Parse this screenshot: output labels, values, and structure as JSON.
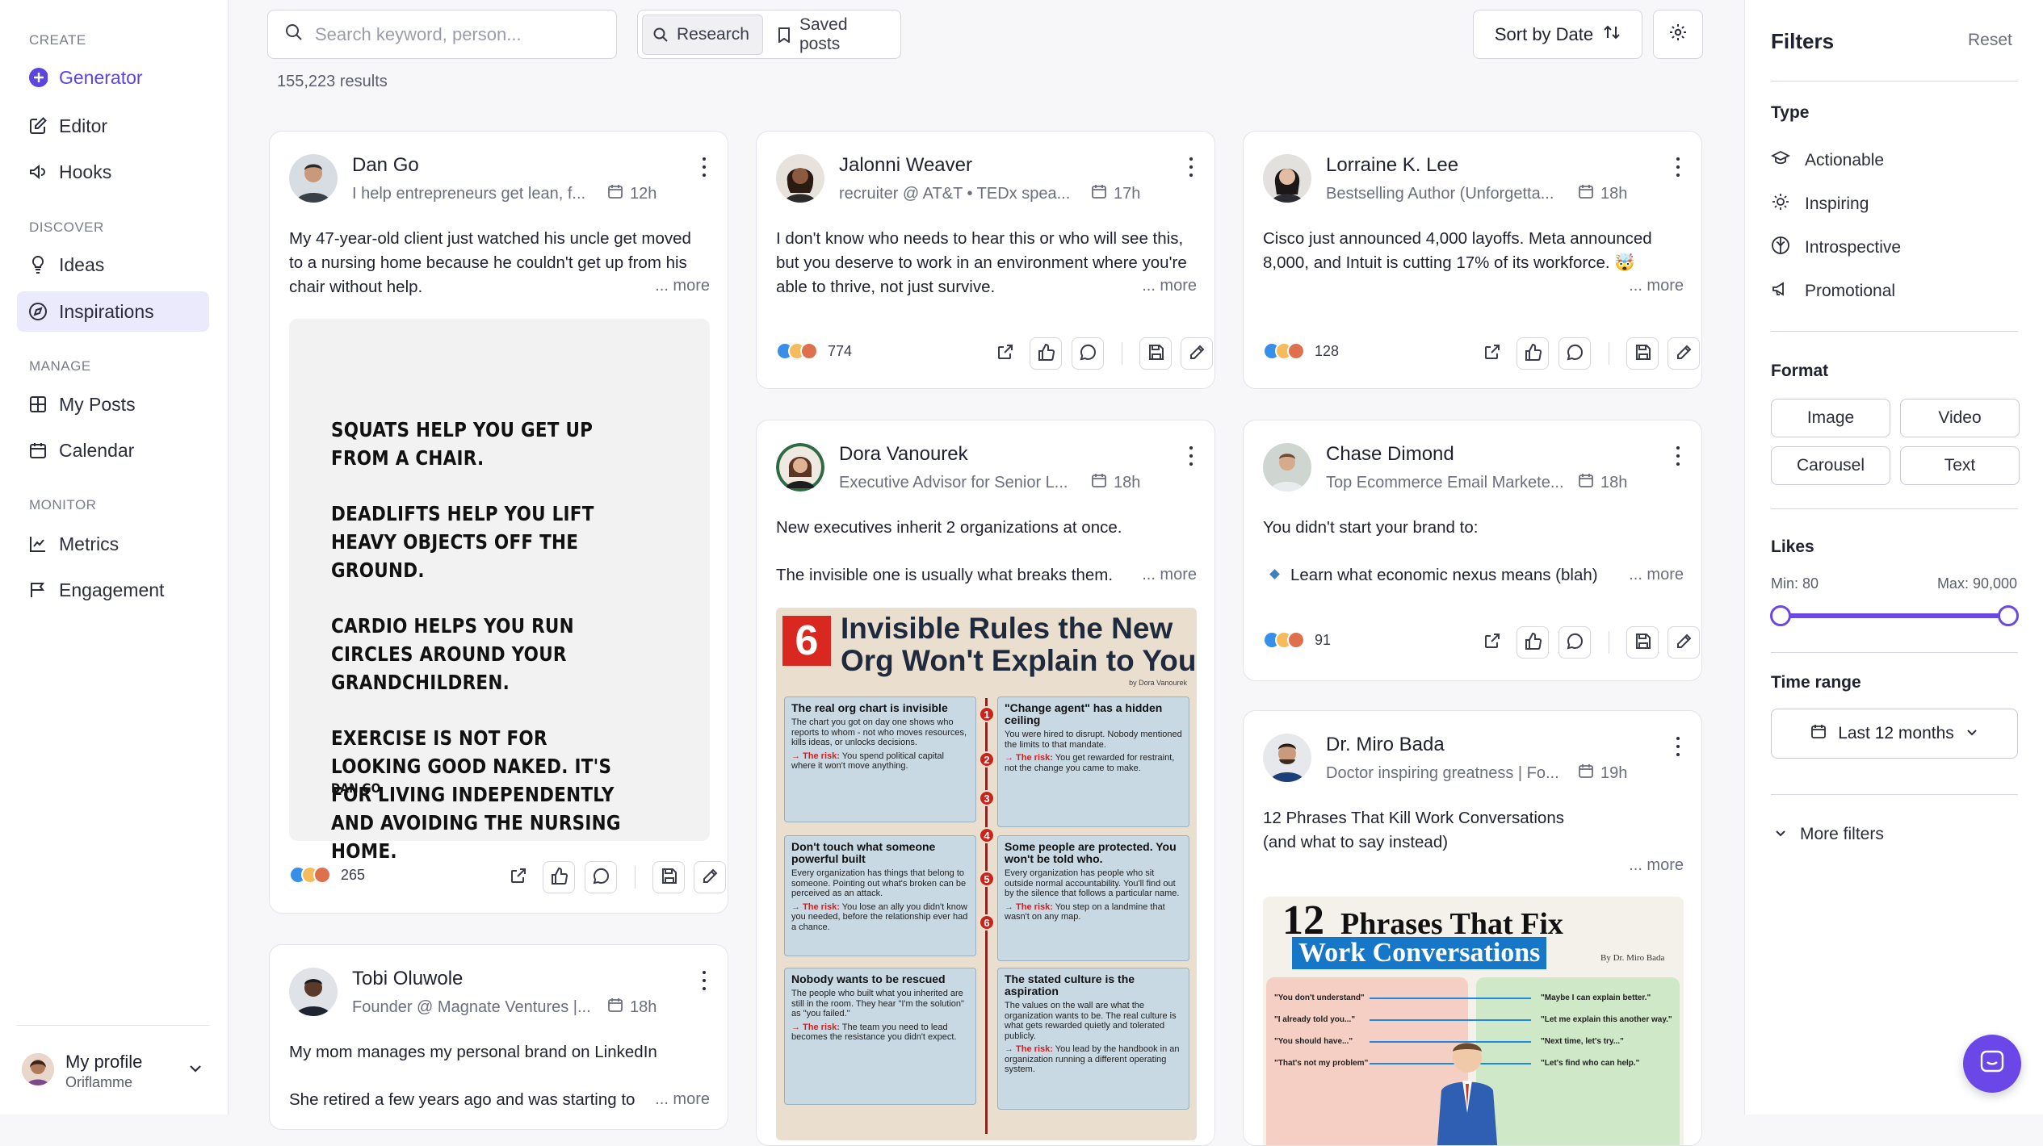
{
  "sidebar": {
    "sections": {
      "create": "CREATE",
      "discover": "DISCOVER",
      "manage": "MANAGE",
      "monitor": "MONITOR"
    },
    "items": {
      "generator": "Generator",
      "editor": "Editor",
      "hooks": "Hooks",
      "ideas": "Ideas",
      "inspirations": "Inspirations",
      "my_posts": "My Posts",
      "calendar": "Calendar",
      "metrics": "Metrics",
      "engagement": "Engagement"
    },
    "profile": {
      "name": "My profile",
      "org": "Oriflamme"
    },
    "accent": "#5b45e0"
  },
  "toolbar": {
    "search_placeholder": "Search keyword, person...",
    "research": "Research",
    "saved_posts": "Saved posts",
    "sort": "Sort by Date",
    "results": "155,223 results"
  },
  "posts": [
    {
      "name": "Dan Go",
      "sub": "I help entrepreneurs get lean, f...",
      "time": "12h",
      "text": "My 47-year-old client just watched his uncle get moved to a nursing home because he couldn't get up from his chair without help.",
      "more": "... more",
      "likes": "265",
      "quote": [
        "SQUATS HELP YOU GET UP FROM A CHAIR.",
        "DEADLIFTS HELP YOU LIFT HEAVY OBJECTS OFF THE GROUND.",
        "CARDIO HELPS YOU RUN CIRCLES AROUND YOUR GRANDCHILDREN.",
        "EXERCISE IS NOT FOR LOOKING GOOD NAKED. IT'S FOR LIVING INDEPENDENTLY AND AVOIDING THE NURSING HOME."
      ],
      "quote_author": "DAN GO"
    },
    {
      "name": "Tobi Oluwole",
      "sub": "Founder @ Magnate Ventures |...",
      "time": "18h",
      "text1": "My mom manages my personal brand on LinkedIn",
      "text2": "She retired a few years ago and was starting to",
      "more": "... more"
    },
    {
      "name": "Jalonni Weaver",
      "sub": "recruiter @ AT&T • TEDx spea...",
      "time": "17h",
      "text": "I don't know who needs to hear this or who will see this, but you deserve to work in an environment where you're able to thrive, not just survive.",
      "more": "... more",
      "likes": "774"
    },
    {
      "name": "Dora Vanourek",
      "sub": "Executive Advisor for Senior L...",
      "time": "18h",
      "text1": "New executives inherit 2 organizations at once.",
      "text2": "The invisible one is usually what breaks them.",
      "more": "... more",
      "infographic": {
        "num": "6",
        "title1": "Invisible Rules the New",
        "title2": "Org Won't Explain to You",
        "byline": "by Dora Vanourek",
        "risk_label": "→ The risk:",
        "rules": [
          {
            "n": "1",
            "head": "The real org chart is invisible",
            "body": "The chart you got on day one shows who reports to whom - not who moves resources, kills ideas, or unlocks decisions.",
            "risk": "You spend political capital where it won't move anything."
          },
          {
            "n": "2",
            "head": "\"Change agent\" has a hidden ceiling",
            "body": "You were hired to disrupt. Nobody mentioned the limits to that mandate.",
            "risk": "You get rewarded for restraint, not the change you came to make."
          },
          {
            "n": "3",
            "head": "Don't touch what someone powerful built",
            "body": "Every organization has things that belong to someone. Pointing out what's broken can be perceived as an attack.",
            "risk": "You lose an ally you didn't know you needed, before the relationship ever had a chance."
          },
          {
            "n": "4",
            "head": "Some people are protected. You won't be told who.",
            "body": "Every organization has people who sit outside normal accountability. You'll find out by the silence that follows a particular name.",
            "risk": "You step on a landmine that wasn't on any map."
          },
          {
            "n": "5",
            "head": "Nobody wants to be rescued",
            "body": "The people who built what you inherited are still in the room. They hear \"I'm the solution\" as \"you failed.\"",
            "risk": "The team you need to lead becomes the resistance you didn't expect."
          },
          {
            "n": "6",
            "head": "The stated culture is the aspiration",
            "body": "The values on the wall are what the organization wants to be. The real culture is what gets rewarded quietly and tolerated publicly.",
            "risk": "You lead by the handbook in an organization running a different operating system."
          }
        ]
      }
    },
    {
      "name": "Lorraine K. Lee",
      "sub": "Bestselling Author (Unforgetta...",
      "time": "18h",
      "text": "Cisco just announced 4,000 layoffs. Meta announced 8,000, and Intuit is cutting 17% of its workforce. 🤯",
      "more": "... more",
      "likes": "128"
    },
    {
      "name": "Chase Dimond",
      "sub": "Top Ecommerce Email Markete...",
      "time": "18h",
      "text1": "You didn't start your brand to:",
      "text2": "Learn what economic nexus means (blah)",
      "more": "... more",
      "likes": "91"
    },
    {
      "name": "Dr. Miro Bada",
      "sub": "Doctor inspiring greatness | Fo...",
      "time": "19h",
      "text1": "12 Phrases That Kill Work Conversations",
      "text2": "(and what to say instead)",
      "more": "... more",
      "infographic": {
        "num": "12",
        "title1": "Phrases That Fix",
        "title2": "Work Conversations",
        "byline": "By Dr. Miro Bada",
        "left": [
          "\"You don't understand\"",
          "\"I already told you...\"",
          "\"You should have...\"",
          "\"That's not my problem\""
        ],
        "right": [
          "\"Maybe I can explain better.\"",
          "\"Let me explain this another way.\"",
          "\"Next time, let's try...\"",
          "\"Let's find who can help.\""
        ]
      }
    }
  ],
  "filters": {
    "title": "Filters",
    "reset": "Reset",
    "type_label": "Type",
    "types": [
      "Actionable",
      "Inspiring",
      "Introspective",
      "Promotional"
    ],
    "format_label": "Format",
    "formats": [
      "Image",
      "Video",
      "Carousel",
      "Text"
    ],
    "likes_label": "Likes",
    "likes_min": "Min: 80",
    "likes_max": "Max: 90,000",
    "likes_range_fraction": [
      0,
      1
    ],
    "time_label": "Time range",
    "time_value": "Last 12 months",
    "more_filters": "More filters"
  }
}
